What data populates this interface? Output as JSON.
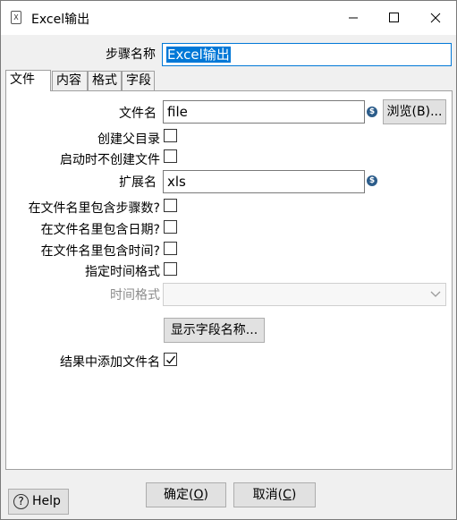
{
  "window": {
    "title": "Excel输出",
    "icon": "excel-file-icon"
  },
  "step_name": {
    "label": "步骤名称",
    "value": "Excel输出"
  },
  "tabs": [
    {
      "label": "文件",
      "active": true
    },
    {
      "label": "内容",
      "active": false
    },
    {
      "label": "格式",
      "active": false
    },
    {
      "label": "字段",
      "active": false
    }
  ],
  "file_tab": {
    "filename_label": "文件名",
    "filename_value": "file",
    "browse_button": "浏览(B)...",
    "create_parent_dir_label": "创建父目录",
    "no_create_on_start_label": "启动时不创建文件",
    "extension_label": "扩展名",
    "extension_value": "xls",
    "include_stepnr_label": "在文件名里包含步骤数?",
    "include_date_label": "在文件名里包含日期?",
    "include_time_label": "在文件名里包含时间?",
    "specify_time_format_label": "指定时间格式",
    "time_format_label": "时间格式",
    "time_format_value": "",
    "show_fields_button": "显示字段名称...",
    "add_to_result_label": "结果中添加文件名",
    "add_to_result_checked": true
  },
  "footer": {
    "help": "Help",
    "ok": "确定",
    "ok_key": "O",
    "cancel": "取消",
    "cancel_key": "C"
  }
}
